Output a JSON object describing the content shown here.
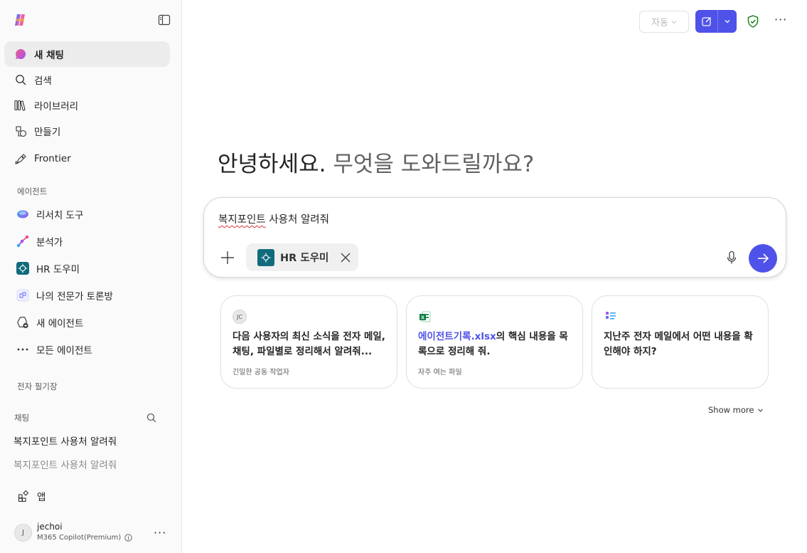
{
  "sidebar": {
    "nav": [
      {
        "label": "새 채팅",
        "icon": "new-chat-icon"
      },
      {
        "label": "검색",
        "icon": "search-icon"
      },
      {
        "label": "라이브러리",
        "icon": "library-icon"
      },
      {
        "label": "만들기",
        "icon": "create-icon"
      },
      {
        "label": "Frontier",
        "icon": "frontier-icon"
      }
    ],
    "agents_section": "에이전트",
    "agents": [
      {
        "label": "리서치 도구",
        "icon": "researcher-icon"
      },
      {
        "label": "분석가",
        "icon": "analyst-icon"
      },
      {
        "label": "HR 도우미",
        "icon": "hr-helper-icon"
      },
      {
        "label": "나의 전문가 토론방",
        "icon": "expert-room-icon"
      },
      {
        "label": "새 에이전트",
        "icon": "new-agent-icon"
      },
      {
        "label": "모든 에이전트",
        "icon": "more-icon"
      }
    ],
    "notebook_section": "전자 필기장",
    "chats_section": "채팅",
    "chats": [
      "복지포인트 사용처 알려줘",
      "복지포인트 사용처 알려줘"
    ],
    "apps_label": "앱",
    "user": {
      "initial": "J",
      "name": "jechoi",
      "plan": "M365 Copilot(Premium)"
    }
  },
  "header": {
    "mode_label": "자동",
    "new_chat_icon": "compose-icon",
    "shield_icon": "shield-check-icon",
    "more_label": "···"
  },
  "greeting": {
    "part1": "안녕하세요.",
    "part2": " 무엇을 도와드릴까요?"
  },
  "composer": {
    "text_part1": "복지포인트",
    "text_part2": " 사용처 알려줘",
    "agent_chip": "HR 도우미"
  },
  "cards": [
    {
      "badge": "JC",
      "text": "다음 사용자의 최신 소식을 전자 메일, 채팅, 파일별로 정리해서 알려줘...",
      "sub": "긴밀한 공동 작업자"
    },
    {
      "link": "에이전트기록.xlsx",
      "text": "의 핵심 내용을 목록으로 정리해 줘.",
      "sub": "자주 여는 파일"
    },
    {
      "text": "지난주 전자 메일에서 어떤 내용을 확인해야 하지?",
      "sub": ""
    }
  ],
  "show_more": "Show more",
  "colors": {
    "accent": "#4f52e8",
    "hr_teal": "#116b7c",
    "shield_green": "#107c10"
  }
}
